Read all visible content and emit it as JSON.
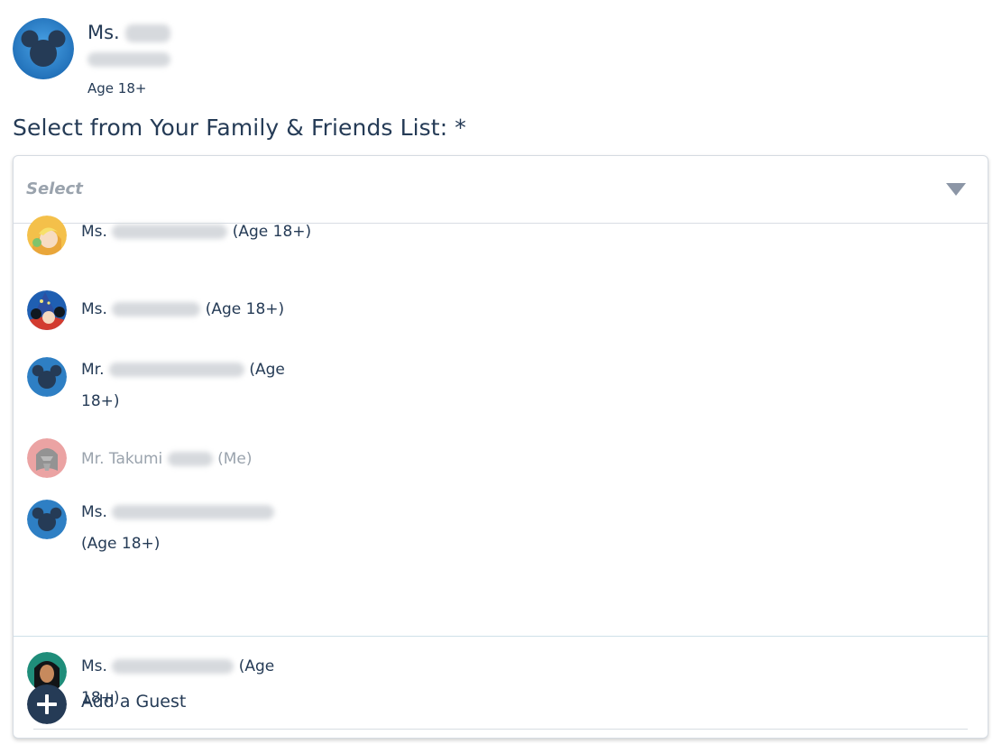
{
  "guest": {
    "title": "Ms.",
    "age": "Age 18+",
    "avatar_icon": "mickey-icon"
  },
  "form": {
    "label": "Select from Your Family & Friends List: *",
    "placeholder": "Select"
  },
  "options": [
    {
      "title": "Ms.",
      "suffix": "(Age 18+)",
      "icon": "tinker-bell-icon"
    },
    {
      "title": "Ms.",
      "suffix": "(Age 18+)",
      "icon": "sorcerer-mickey-icon"
    },
    {
      "title": "Mr.",
      "suffix_a": "(Age",
      "suffix_b": "18+)",
      "icon": "mickey-icon"
    },
    {
      "title": "Mr. Takumi",
      "suffix": "(Me)",
      "icon": "darth-vader-icon",
      "disabled": true
    },
    {
      "title": "Ms.",
      "suffix": "(Age 18+)",
      "icon": "mickey-icon"
    },
    {
      "title": "Ms.",
      "suffix_a": "(Age",
      "suffix_b": "18+)",
      "icon": "pocahontas-icon"
    }
  ],
  "add_guest": {
    "label": "Add a Guest",
    "icon": "plus-icon"
  },
  "colors": {
    "text": "#253b56",
    "muted": "#9aa3ad",
    "mickey_blue": "#2e7fc4",
    "border": "#d5dbe2"
  }
}
